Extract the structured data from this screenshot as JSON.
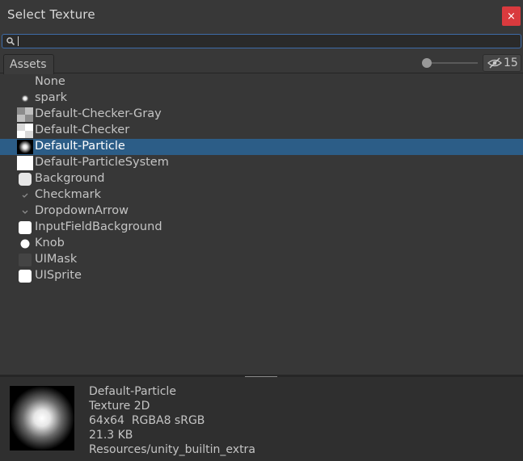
{
  "window": {
    "title": "Select Texture",
    "close_symbol": "×"
  },
  "search": {
    "value": "",
    "placeholder": ""
  },
  "tabs": {
    "active": "Assets"
  },
  "hidden_count": "15",
  "items": [
    {
      "label": "None",
      "thumb": "none",
      "selected": false
    },
    {
      "label": "spark",
      "thumb": "spark",
      "selected": false
    },
    {
      "label": "Default-Checker-Gray",
      "thumb": "checker-gray",
      "selected": false
    },
    {
      "label": "Default-Checker",
      "thumb": "checker",
      "selected": false
    },
    {
      "label": "Default-Particle",
      "thumb": "particle",
      "selected": true
    },
    {
      "label": "Default-ParticleSystem",
      "thumb": "white-square",
      "selected": false
    },
    {
      "label": "Background",
      "thumb": "rounded-light",
      "selected": false
    },
    {
      "label": "Checkmark",
      "thumb": "checkmark",
      "selected": false
    },
    {
      "label": "DropdownArrow",
      "thumb": "dropdown-arrow",
      "selected": false
    },
    {
      "label": "InputFieldBackground",
      "thumb": "rounded-white",
      "selected": false
    },
    {
      "label": "Knob",
      "thumb": "knob",
      "selected": false
    },
    {
      "label": "UIMask",
      "thumb": "dark-square",
      "selected": false
    },
    {
      "label": "UISprite",
      "thumb": "rounded-white",
      "selected": false
    }
  ],
  "preview": {
    "name": "Default-Particle",
    "type": "Texture 2D",
    "format": "64x64  RGBA8 sRGB",
    "size": "21.3 KB",
    "path": "Resources/unity_builtin_extra"
  },
  "colors": {
    "selection": "#2c5d87",
    "close_button": "#d93a3e",
    "search_focus": "#3e6ca8"
  }
}
